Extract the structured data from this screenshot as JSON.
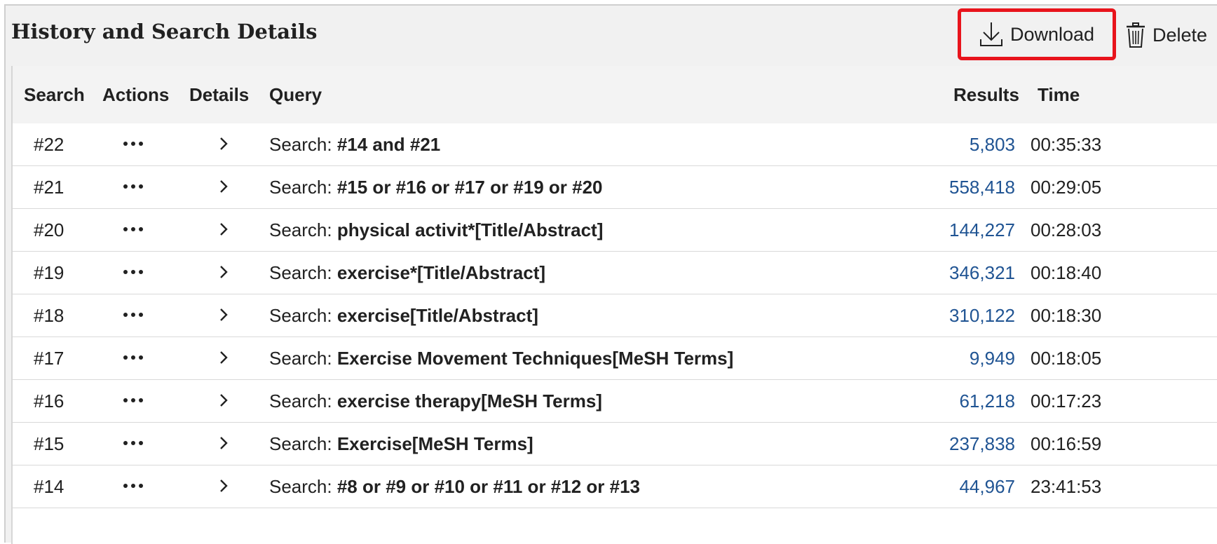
{
  "panel": {
    "title": "History and Search Details",
    "download_label": "Download",
    "delete_label": "Delete"
  },
  "table": {
    "headers": {
      "search": "Search",
      "actions": "Actions",
      "details": "Details",
      "query": "Query",
      "results": "Results",
      "time": "Time"
    },
    "rows": [
      {
        "search": "#22",
        "prefix": "Search: ",
        "term": "#14 and #21",
        "results": "5,803",
        "time": "00:35:33"
      },
      {
        "search": "#21",
        "prefix": "Search: ",
        "term": "#15 or #16 or #17 or #19 or #20",
        "results": "558,418",
        "time": "00:29:05"
      },
      {
        "search": "#20",
        "prefix": "Search: ",
        "term": "physical activit*[Title/Abstract]",
        "results": "144,227",
        "time": "00:28:03"
      },
      {
        "search": "#19",
        "prefix": "Search: ",
        "term": "exercise*[Title/Abstract]",
        "results": "346,321",
        "time": "00:18:40"
      },
      {
        "search": "#18",
        "prefix": "Search: ",
        "term": "exercise[Title/Abstract]",
        "results": "310,122",
        "time": "00:18:30"
      },
      {
        "search": "#17",
        "prefix": "Search: ",
        "term": "Exercise Movement Techniques[MeSH Terms]",
        "results": "9,949",
        "time": "00:18:05"
      },
      {
        "search": "#16",
        "prefix": "Search: ",
        "term": "exercise therapy[MeSH Terms]",
        "results": "61,218",
        "time": "00:17:23"
      },
      {
        "search": "#15",
        "prefix": "Search: ",
        "term": "Exercise[MeSH Terms]",
        "results": "237,838",
        "time": "00:16:59"
      },
      {
        "search": "#14",
        "prefix": "Search: ",
        "term": "#8 or #9 or #10 or #11 or #12 or #13",
        "results": "44,967",
        "time": "23:41:53"
      }
    ]
  },
  "icons": {
    "download": "download-icon",
    "delete": "trash-icon",
    "actions": "more-dots-icon",
    "details": "chevron-right-icon"
  },
  "colors": {
    "highlight_border": "#e8141c",
    "results_link": "#205493",
    "header_bg": "#f3f3f3"
  }
}
